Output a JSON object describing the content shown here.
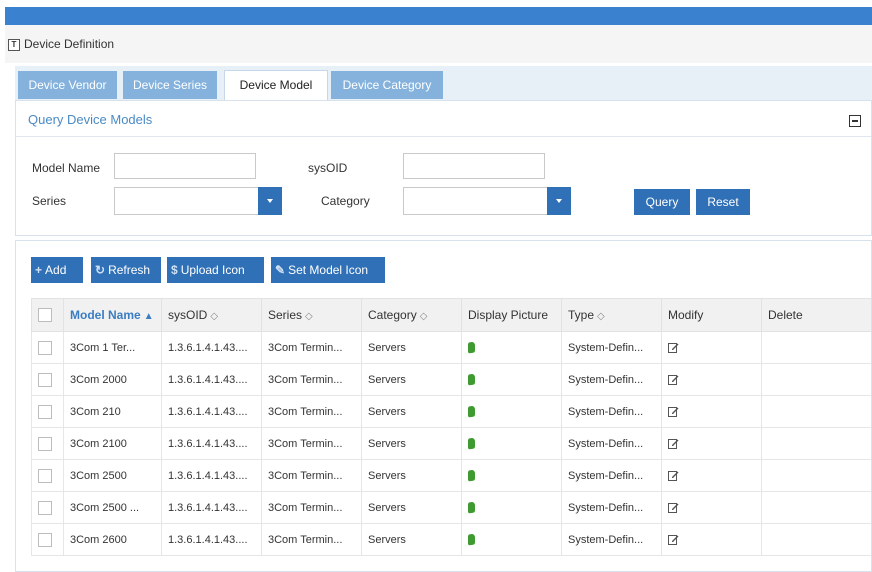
{
  "page": {
    "title": "Device Definition",
    "title_icon": "T"
  },
  "tabs": [
    {
      "label": "Device Vendor",
      "active": false
    },
    {
      "label": "Device Series",
      "active": false
    },
    {
      "label": "Device Model",
      "active": true
    },
    {
      "label": "Device Category",
      "active": false
    }
  ],
  "query": {
    "title": "Query Device Models",
    "model_name_label": "Model Name",
    "model_name_value": "",
    "sysoid_label": "sysOID",
    "sysoid_value": "",
    "series_label": "Series",
    "series_value": "",
    "category_label": "Category",
    "category_value": "",
    "query_button": "Query",
    "reset_button": "Reset"
  },
  "toolbar": {
    "add": "Add",
    "refresh": "Refresh",
    "upload_icon": "Upload Icon",
    "set_model_icon": "Set Model Icon"
  },
  "table": {
    "columns": [
      "Model Name",
      "sysOID",
      "Series",
      "Category",
      "Display Picture",
      "Type",
      "Modify",
      "Delete"
    ],
    "rows": [
      {
        "model": "3Com 1 Ter...",
        "sysoid": "1.3.6.1.4.1.43....",
        "series": "3Com Termin...",
        "category": "Servers",
        "type": "System-Defin..."
      },
      {
        "model": "3Com 2000",
        "sysoid": "1.3.6.1.4.1.43....",
        "series": "3Com Termin...",
        "category": "Servers",
        "type": "System-Defin..."
      },
      {
        "model": "3Com 210",
        "sysoid": "1.3.6.1.4.1.43....",
        "series": "3Com Termin...",
        "category": "Servers",
        "type": "System-Defin..."
      },
      {
        "model": "3Com 2100",
        "sysoid": "1.3.6.1.4.1.43....",
        "series": "3Com Termin...",
        "category": "Servers",
        "type": "System-Defin..."
      },
      {
        "model": "3Com 2500",
        "sysoid": "1.3.6.1.4.1.43....",
        "series": "3Com Termin...",
        "category": "Servers",
        "type": "System-Defin..."
      },
      {
        "model": "3Com 2500 ...",
        "sysoid": "1.3.6.1.4.1.43....",
        "series": "3Com Termin...",
        "category": "Servers",
        "type": "System-Defin..."
      },
      {
        "model": "3Com 2600",
        "sysoid": "1.3.6.1.4.1.43....",
        "series": "3Com Termin...",
        "category": "Servers",
        "type": "System-Defin..."
      }
    ]
  },
  "colors": {
    "accent": "#2f70b6",
    "topbar": "#3a82d0",
    "tab_inactive": "#84b2dc",
    "header_link": "#4a8ac4"
  }
}
